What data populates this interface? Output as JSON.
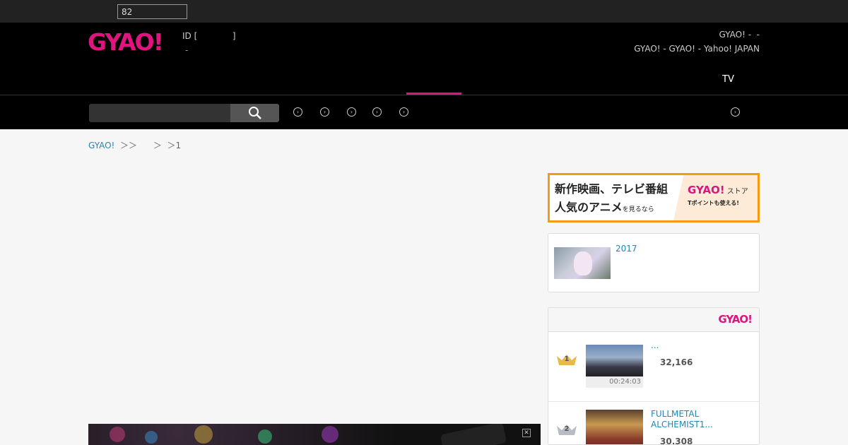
{
  "topbar": {
    "search_value": "82"
  },
  "header": {
    "logo": "GYAO!",
    "user_id": "ID [             ]",
    "user_dash": "-",
    "links_row1": "GYAO! -  -",
    "links_row2": "GYAO! - GYAO! - Yahoo! JAPAN",
    "nav_tv": "TV"
  },
  "subnav": {
    "search_placeholder": ""
  },
  "breadcrumb": {
    "home": "GYAO!",
    "rest": "  ＞＞      ＞  ＞1"
  },
  "ad": {
    "line1": "新作映画、テレビ番組",
    "line2": "人気のアニメ",
    "line2_small": "を見るなら",
    "brand": "GYAO!",
    "brand_suffix": " ストア",
    "tpoint": "Tポイントも使える!"
  },
  "feature": {
    "title": "2017"
  },
  "ranking": {
    "brand": "GYAO!",
    "items": [
      {
        "rank": "1",
        "title": "...",
        "views": "32,166",
        "duration": "00:24:03"
      },
      {
        "rank": "2",
        "title": " FULLMETAL ALCHEMIST1...",
        "views": "30,308",
        "duration": ""
      }
    ]
  },
  "colors": {
    "brand": "#e0147f",
    "link": "#1a8ab5",
    "ad_border": "#f39c12"
  }
}
